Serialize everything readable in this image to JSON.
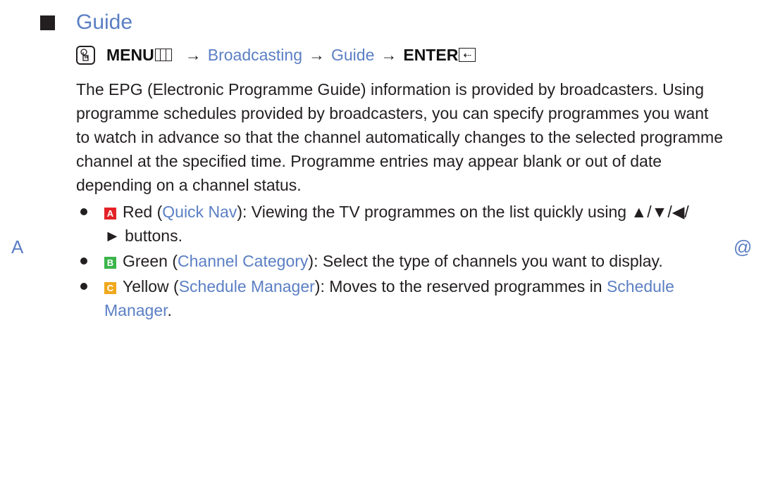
{
  "section": {
    "title": "Guide"
  },
  "menu_path": {
    "menu_label": "MENU",
    "arrow": "→",
    "steps": [
      "Broadcasting",
      "Guide"
    ],
    "enter_label": "ENTER",
    "enter_glyph": "⇠"
  },
  "description": "The EPG (Electronic Programme Guide) information is provided by broadcasters. Using programme schedules provided by broadcasters, you can specify programmes you want to watch in advance so that the channel automatically changes to the selected programme channel at the specified time. Programme entries may appear blank or out of date depending on a channel status.",
  "bullets": [
    {
      "key": "A",
      "color_name": "Red",
      "open": " (",
      "feature": "Quick Nav",
      "text": "): Viewing the TV programmes on the list quickly using ▲/▼/◀/► buttons."
    },
    {
      "key": "B",
      "color_name": "Green",
      "open": " (",
      "feature": "Channel Category",
      "text": "): Select the type of channels you want to display."
    },
    {
      "key": "C",
      "color_name": "Yellow",
      "open": " (",
      "feature": "Schedule Manager",
      "text": "): Moves to the reserved programmes in ",
      "link_end": "Schedule Manager",
      "end": "."
    }
  ],
  "side_markers": {
    "left": "A",
    "right": "@"
  },
  "colors": {
    "accent_blue": "#5b7fc4",
    "key_red": "#e32227",
    "key_green": "#3bb54a",
    "key_yellow": "#f0a81c"
  }
}
